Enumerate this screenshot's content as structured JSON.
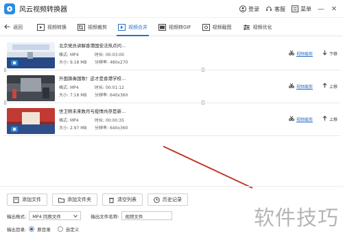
{
  "titlebar": {
    "app_title": "风云视频转换器",
    "login": "登录",
    "service": "客服",
    "menu": "菜单",
    "minimize": "—",
    "close": "✕"
  },
  "tabs": {
    "back": "返回",
    "items": [
      {
        "label": "视频转换",
        "icon": "video-convert-icon"
      },
      {
        "label": "视频裁剪",
        "icon": "crop-icon"
      },
      {
        "label": "视频合并",
        "icon": "merge-icon"
      },
      {
        "label": "视频转GIF",
        "icon": "gif-icon"
      },
      {
        "label": "视频截图",
        "icon": "screenshot-icon"
      },
      {
        "label": "视频优化",
        "icon": "optimize-icon"
      }
    ],
    "active_index": 2
  },
  "files": [
    {
      "name": "北京党员讲解香港国安法热点问...",
      "format_label": "格式:",
      "format": "MP4",
      "duration_label": "时长:",
      "duration": "00:03:00",
      "size_label": "大小:",
      "size": "9.18 MB",
      "resolution_label": "分辨率:",
      "resolution": "480x270",
      "crop": "视频裁剪",
      "move": "下移",
      "thumb_caption": "风云视频转换器"
    },
    {
      "name": "升国旗奏国歌！这才是香港学校...",
      "format_label": "格式:",
      "format": "MP4",
      "duration_label": "时长:",
      "duration": "00:01:12",
      "size_label": "大小:",
      "size": "7.18 MB",
      "resolution_label": "分辨率:",
      "resolution": "640x360",
      "crop": "视频裁剪",
      "move": "上移",
      "thumb_caption": ""
    },
    {
      "name": "世卫称未来数月与疫情共存是新...",
      "format_label": "格式:",
      "format": "MP4",
      "duration_label": "时长:",
      "duration": "00:00:35",
      "size_label": "大小:",
      "size": "2.97 MB",
      "resolution_label": "分辨率:",
      "resolution": "640x360",
      "crop": "视频裁剪",
      "move": "上移",
      "thumb_caption": "风云视频转换器"
    }
  ],
  "buttons": {
    "add_file": "添加文件",
    "add_folder": "添加文件夹",
    "clear_list": "清空列表",
    "history": "历史记录"
  },
  "output": {
    "format_label": "输出格式:",
    "format_value": "MP4 同原文件",
    "name_label": "输出文件名称:",
    "name_value": "视频文件",
    "dir_label": "输出目录:",
    "dir_options": [
      "原目录",
      "自定义"
    ],
    "dir_selected": 0
  },
  "watermark": "软件技巧",
  "colors": {
    "accent": "#2a6dc4",
    "annotation_arrow": "#c0392b"
  }
}
